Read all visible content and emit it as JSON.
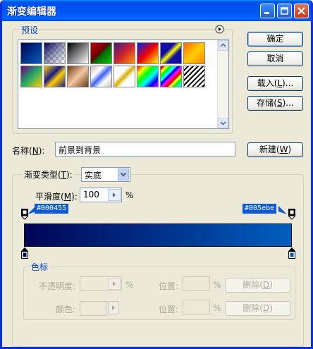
{
  "window": {
    "title": "渐变编辑器"
  },
  "presets": {
    "label": "预设"
  },
  "buttons": {
    "ok": "确定",
    "cancel": "取消",
    "load": "载入",
    "load_key": "L",
    "save": "存储",
    "save_key": "S",
    "new": "新建",
    "new_key": "W"
  },
  "name_field": {
    "label": "名称",
    "key": "N",
    "value": "前景到背景"
  },
  "gradient": {
    "type_label": "渐变类型",
    "type_key": "T",
    "type_value": "实底",
    "smoothness_label": "平滑度",
    "smoothness_key": "M",
    "smoothness_value": "100",
    "percent": "%",
    "left_color": "#000455",
    "right_color": "#005ebe"
  },
  "color_stops": {
    "label": "色标",
    "opacity_label": "不透明度",
    "percent": "%",
    "position_label": "位置",
    "color_label": "颜色",
    "delete_label": "删除",
    "delete_key": "D"
  },
  "colors": {
    "accent": "#0046D5",
    "title_bar": "#0054E3"
  }
}
